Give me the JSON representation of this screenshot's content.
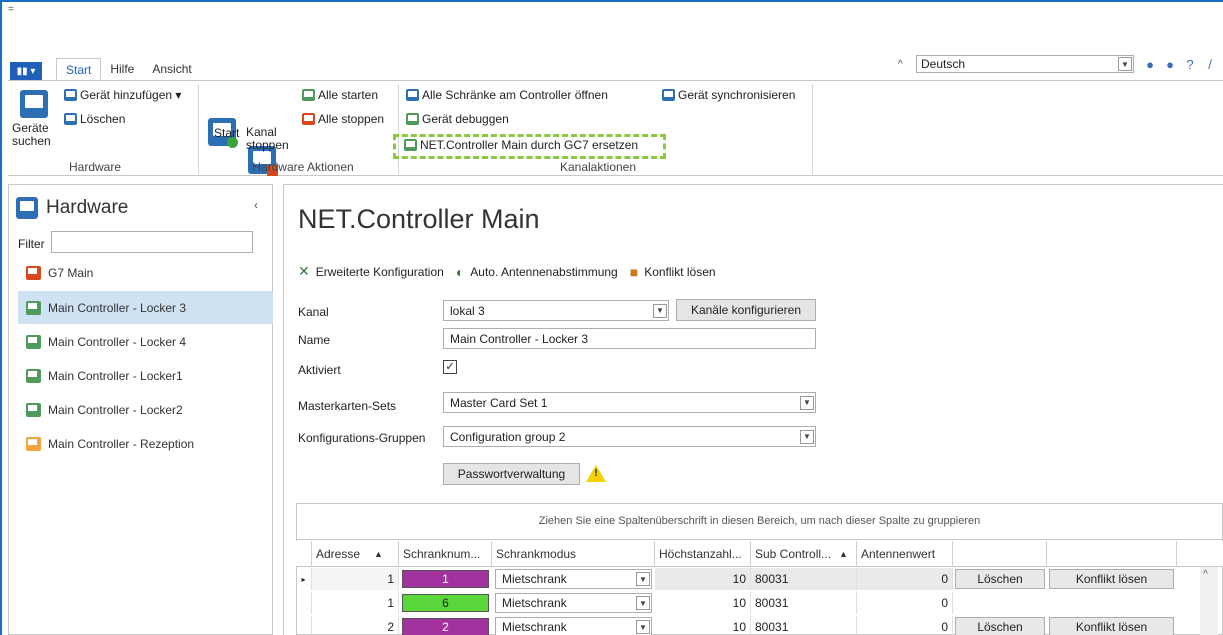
{
  "qat_symbol": "=",
  "ribbon": {
    "file_icon": "▮▮ ▾",
    "tabs": [
      "Start",
      "Hilfe",
      "Ansicht"
    ],
    "active_tab": "Start",
    "language": "Deutsch",
    "buttons": {
      "devices_search": "Geräte\nsuchen",
      "device_add": "Gerät hinzufügen",
      "delete": "Löschen",
      "start": "Start",
      "channel_stop": "Kanal\nstoppen",
      "start_all": "Alle starten",
      "stop_all": "Alle stoppen",
      "open_all_lockers": "Alle Schränke am Controller öffnen",
      "debug_device": "Gerät debuggen",
      "replace_controller": "NET.Controller Main durch GC7 ersetzen",
      "sync_device": "Gerät synchronisieren"
    },
    "groups": {
      "hardware": "Hardware",
      "hardware_actions": "Hardware Aktionen",
      "channel_actions": "Kanalaktionen"
    }
  },
  "sidebar": {
    "title": "Hardware",
    "filter_label": "Filter",
    "filter_value": "",
    "items": [
      {
        "label": "G7 Main",
        "color": "#d9481c"
      },
      {
        "label": "Main Controller - Locker 3",
        "color": "#4f9b5b",
        "selected": true
      },
      {
        "label": "Main Controller - Locker 4",
        "color": "#4f9b5b"
      },
      {
        "label": "Main Controller - Locker1",
        "color": "#4f9b5b"
      },
      {
        "label": "Main Controller - Locker2",
        "color": "#4f9b5b"
      },
      {
        "label": "Main Controller - Rezeption",
        "color": "#f3a53b"
      }
    ]
  },
  "main": {
    "title": "NET.Controller Main",
    "actions": [
      "Erweiterte Konfiguration",
      "Auto. Antennenabstimmung",
      "Konflikt lösen"
    ],
    "form": {
      "channel_label": "Kanal",
      "channel_value": "lokal 3",
      "configure_channels": "Kanäle konfigurieren",
      "name_label": "Name",
      "name_value": "Main Controller - Locker 3",
      "active_label": "Aktiviert",
      "active_check": "✓",
      "master_label": "Masterkarten-Sets",
      "master_value": "Master Card Set 1",
      "config_label": "Konfigurations-Gruppen",
      "config_value": "Configuration group 2",
      "password_button": "Passwortverwaltung",
      "warning_symbol": "!"
    },
    "grid": {
      "group_hint": "Ziehen Sie eine Spaltenüberschrift in diesen Bereich, um nach dieser Spalte zu gruppieren",
      "headers": [
        "Adresse",
        "Schranknum...",
        "Schrankmodus",
        "Höchstanzahl...",
        "Sub Controll...",
        "Antennenwert"
      ],
      "sort_asc": "▲",
      "rows": [
        {
          "indicator": "▸",
          "address": "1",
          "locker": "1",
          "locker_color": "#a3329f",
          "mode": "Mietschrank",
          "max": "10",
          "sub": "80031",
          "antenna": "0",
          "delete": "Löschen",
          "resolve": "Konflikt lösen"
        },
        {
          "indicator": "",
          "address": "1",
          "locker": "6",
          "locker_color": "#58d63a",
          "mode": "Mietschrank",
          "max": "10",
          "sub": "80031",
          "antenna": "0",
          "delete": "",
          "resolve": ""
        },
        {
          "indicator": "",
          "address": "2",
          "locker": "2",
          "locker_color": "#a3329f",
          "mode": "Mietschrank",
          "max": "10",
          "sub": "80031",
          "antenna": "0",
          "delete": "Löschen",
          "resolve": "Konflikt lösen"
        }
      ]
    }
  }
}
